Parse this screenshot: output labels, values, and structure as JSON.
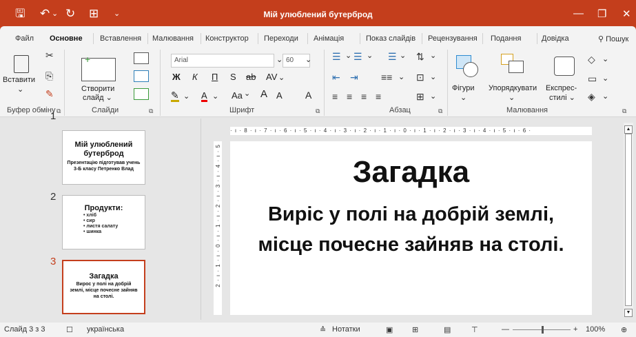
{
  "window": {
    "title": "Мій улюблений бутерброд",
    "minimize": "—",
    "restore": "❐",
    "close": "✕"
  },
  "quick_access": {
    "save_icon": "🖫",
    "undo_icon": "↶",
    "undo_arrow": "⌄",
    "redo_icon": "↻",
    "present_icon": "⊞",
    "more_icon": "⌄"
  },
  "tabs": [
    "Файл",
    "Основне",
    "Вставлення",
    "Малювання",
    "Конструктор",
    "Переходи",
    "Анімація",
    "Показ слайдів",
    "Рецензування",
    "Подання",
    "Довідка"
  ],
  "search": "Пошук",
  "ribbon": {
    "paste_label": "Вставити",
    "clipboard_group": "Буфер обміну",
    "new_slide_label1": "Створити",
    "new_slide_label2": "слайд ⌄",
    "slides_group": "Слайди",
    "font_name": "Arial",
    "font_size": "60",
    "bold": "Ж",
    "italic": "К",
    "underline": "П",
    "shadow": "S",
    "strike": "ab",
    "spacing": "AV",
    "change_case": "Aa",
    "grow": "A",
    "shrink": "A",
    "font_group": "Шрифт",
    "para_group": "Абзац",
    "shapes_label": "Фігури",
    "arrange_label": "Упорядкувати",
    "quick_styles_label1": "Експрес-",
    "quick_styles_label2": "стилі ⌄",
    "drawing_group": "Малювання"
  },
  "slides": [
    {
      "num": "1",
      "title": "Мій улюблений бутерброд",
      "body": "Презентацію підготував учень 3-Б класу Петренко Влад"
    },
    {
      "num": "2",
      "title": "Продукти:",
      "items": [
        "хліб",
        "сир",
        "листя салату",
        "шинка"
      ]
    },
    {
      "num": "3",
      "title": "Загадка",
      "body": "Вирос у полі на добрій землі, місце почесне зайняв на столі."
    }
  ],
  "current_slide": {
    "title": "Загадка",
    "body": "Виріс у полі на добрій землі, місце почесне зайняв на столі."
  },
  "thumb3_body": "Вирос у полі на добрій землі, місце почесне зайняв на столі.",
  "hruler": "· ı · 8 · ı · 7 · ı · 6 · ı · 5 · ı · 4 · ı · 3 · ı · 2 · ı · 1 · ı · 0 · ı · 1 · ı · 2 · ı · 3 · ı · 4 · ı · 5 · ı · 6 ·",
  "vruler": "2 · ı · 1 · ı · 0 · ı · 1 · ı · 2 · ı · 3 · ı · 4 · ı · 5",
  "status": {
    "slide_info": "Слайд 3 з 3",
    "language": "українська",
    "notes": "Нотатки",
    "zoom": "100%",
    "zoom_minus": "—",
    "zoom_plus": "+"
  },
  "colors": {
    "accent": "#c43e1c"
  }
}
